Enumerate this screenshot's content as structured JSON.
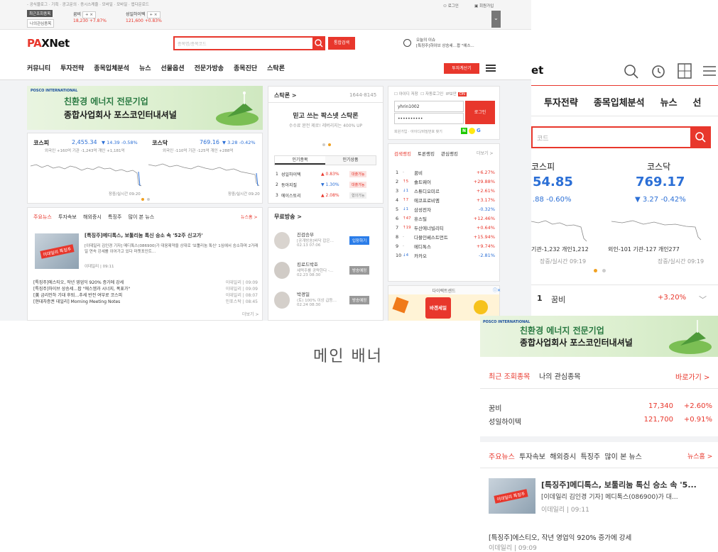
{
  "topbar": {
    "links": "- 공식블로그 · 기획 · 광고문의 · 증시스케줄 · 모바일 · 모바일 · 앱다운로드",
    "recent_label": "최근조회종목",
    "my_label": "나의관심종목",
    "stock1": {
      "name": "꿈비",
      "price": "18,230",
      "change": "+7.87%"
    },
    "stock2": {
      "name": "성일하이텍",
      "price": "121,600",
      "change": "+0.83%"
    },
    "login": "로그인",
    "join": "회원가입"
  },
  "header": {
    "logo_main": "PA",
    "logo_x": "X",
    "logo_net": "Net",
    "search_placeholder": "종목명/종목코드",
    "search_button": "통합검색",
    "ticker_label": "오늘의 이슈",
    "ticker_text": "[특징주]하이브 상승세…팝 \"에스...",
    "invest_button": "투자계산기"
  },
  "nav": [
    "커뮤니티",
    "투자전략",
    "종목입체분석",
    "뉴스",
    "선물옵션",
    "전문가방송",
    "종목진단",
    "스탁론"
  ],
  "banner": {
    "brand": "POSCO INTERNATIONAL",
    "line1": "친환경 에너지 전문기업",
    "line2": "종합사업회사 포스코인터내셔널"
  },
  "indices": {
    "kospi": {
      "name": "코스피",
      "value": "2,455.34",
      "change": "▼ 14.39 -0.58%",
      "sub": "외국인 +160억 기관 -1,243억 개인 +1,181억"
    },
    "kosdaq": {
      "name": "코스닥",
      "value": "769.16",
      "change": "▼ 3.28 -0.42%",
      "sub": "외국인 -110억 기관 -125억 개인 +288억"
    },
    "time_label": "장중/실시간 09:20"
  },
  "news": {
    "tabs": [
      "주요뉴스",
      "투자속보",
      "해외증시",
      "특징주",
      "많이 본 뉴스"
    ],
    "more": "뉴스홈 >",
    "headline": "[특징주]메디톡스, 보툴리눔 톡신 승소 속 '52주 신고가'",
    "summary": "[이데일리 김인경 기자] 메디톡스(086900)가 대웅제약을 상대로 '보툴리눔 톡신' 1심에서 승소하며 2거래일 연속 강세를 이어가고 있다 마켓포인트…",
    "source": "이데일리",
    "time": "09:11",
    "thumb_label": "이데일리 특징주",
    "list": [
      {
        "title": "[특징주]에스티오, 작년 영업익 920% 증가에 강세",
        "src": "이데일리",
        "time": "09:09"
      },
      {
        "title": "[특징주]하이브 상승세…팝 \"에스엠과 시너지, 폭표가\"",
        "src": "이데일리",
        "time": "09:09"
      },
      {
        "title": "[美 금리인하 기대 후퇴…추세 반전 여부로 코스피",
        "src": "이데일리",
        "time": "08:07"
      },
      {
        "title": "[현대차증권 데일리] Morning Meeting Notes",
        "src": "인포스탁",
        "time": "08:45"
      }
    ],
    "more2": "더보기 >"
  },
  "stockloan": {
    "title": "스탁론 >",
    "phone": "1644-8145",
    "slogan": "믿고 쓰는 팍스넷 스탁론",
    "sub": "수수료 완전 제로! 레버리지는 400% UP",
    "tab1": "인기종목",
    "tab2": "인기상품",
    "rows": [
      {
        "rank": "1",
        "name": "성일하이텍",
        "chg": "▲ 0.83%",
        "state": "대출가능"
      },
      {
        "rank": "2",
        "name": "동아지질",
        "chg": "▼ 1.30%",
        "state": "대출가능"
      },
      {
        "rank": "3",
        "name": "에이스토리",
        "chg": "▲ 2.08%",
        "state": "협의가능"
      }
    ]
  },
  "broadcast": {
    "title": "무료방송 >",
    "items": [
      {
        "name": "진검승부",
        "desc": "[공개방송]바닥 잡은…",
        "time": "02.13 07:06",
        "btn": "입장하기"
      },
      {
        "name": "킹로드박호",
        "desc": "세력주를 공략한다 -…",
        "time": "02.23 08:30",
        "btn": "방송예정"
      },
      {
        "name": "박경일",
        "desc": "(토) 100% 이상 급등…",
        "time": "02.24 08:30",
        "btn": "방송예정"
      }
    ]
  },
  "login": {
    "save_id": "아이디 저장",
    "auto_login": "자동로그인",
    "ip_secure": "IP보안",
    "ip_on": "ON",
    "user_id": "yhrin1002",
    "password": "••••••••••",
    "button": "로그인",
    "links": "회원가입 · 아이디/비밀번호 찾기"
  },
  "ranking": {
    "tabs": [
      "검색랭킹",
      "토론랭킹",
      "관심랭킹"
    ],
    "more": "더보기 >",
    "rows": [
      {
        "rank": "1",
        "move": "-",
        "name": "꿈비",
        "chg": "+6.27%"
      },
      {
        "rank": "2",
        "move": "↑5",
        "name": "솔트웨어",
        "chg": "+29.88%"
      },
      {
        "rank": "3",
        "move": "↓1",
        "name": "스튜디오미르",
        "chg": "+2.61%"
      },
      {
        "rank": "4",
        "move": "↑7",
        "name": "에코프로비엠",
        "chg": "+3.17%"
      },
      {
        "rank": "5",
        "move": "↓1",
        "name": "삼성전자",
        "chg": "-0.32%"
      },
      {
        "rank": "6",
        "move": "↑47",
        "name": "휴스틸",
        "chg": "+12.46%"
      },
      {
        "rank": "7",
        "move": "↑19",
        "name": "두산에너빌리티",
        "chg": "+0.64%"
      },
      {
        "rank": "8",
        "move": "-",
        "name": "다믈인베스트먼트",
        "chg": "+15.94%"
      },
      {
        "rank": "9",
        "move": "-",
        "name": "메디톡스",
        "chg": "+9.74%"
      },
      {
        "rank": "10",
        "move": "↓4",
        "name": "카카오",
        "chg": "-2.81%"
      }
    ]
  },
  "ad": {
    "label": "다이렉트센드",
    "badge": "바겐세일"
  },
  "caption": "메인 배너",
  "mobile": {
    "logo_tail": "et",
    "nav": [
      "투자전략",
      "종목입체분석",
      "뉴스",
      "선"
    ],
    "search_placeholder": "코드",
    "kospi": {
      "name": "코스피",
      "value": "54.85",
      "change": ".88 -0.60%",
      "sub": "기관-1,232 개인1,212",
      "time": "장중/실시간 09:19"
    },
    "kosdaq": {
      "name": "코스닥",
      "value": "769.17",
      "change": "▼ 3.27 -0.42%",
      "sub": "외인-101 기관-127 개인277",
      "time": "장중/실시간 09:19"
    },
    "rank1": {
      "rank": "1",
      "name": "꿈비",
      "chg": "+3.20%"
    },
    "banner_line1": "친환경 에너지 전문기업",
    "banner_line2": "종합사업회사 포스코인터내셔널",
    "banner_brand": "POSCO INTERNATIONAL",
    "recent_tab": "최근 조회종목",
    "my_tab": "나의 관심종목",
    "goto": "바로가기 >",
    "recent": [
      {
        "name": "꿈비",
        "price": "17,340",
        "chg": "+2.60%"
      },
      {
        "name": "성일하이텍",
        "price": "121,700",
        "chg": "+0.91%"
      }
    ],
    "news_tabs": [
      "주요뉴스",
      "투자속보",
      "해외증시",
      "특징주",
      "많이 본 뉴스"
    ],
    "news_home": "뉴스홈 >",
    "headline": "[특징주]메디톡스, 보툴리눔 톡신 승소 속 '5...",
    "summary": "[이데일리 김인경 기자] 메디톡스(086900)가 대...",
    "source": "이데일리",
    "time": "09:11",
    "news2": "[특징주]에스티오, 작년 영업익 920% 증가에 강세",
    "news2_src": "이데일리",
    "news2_time": "09:09"
  },
  "colors": {
    "accent": "#e8372c",
    "up": "#e8372c",
    "down": "#2b6fd6",
    "green": "#2a7a42"
  }
}
